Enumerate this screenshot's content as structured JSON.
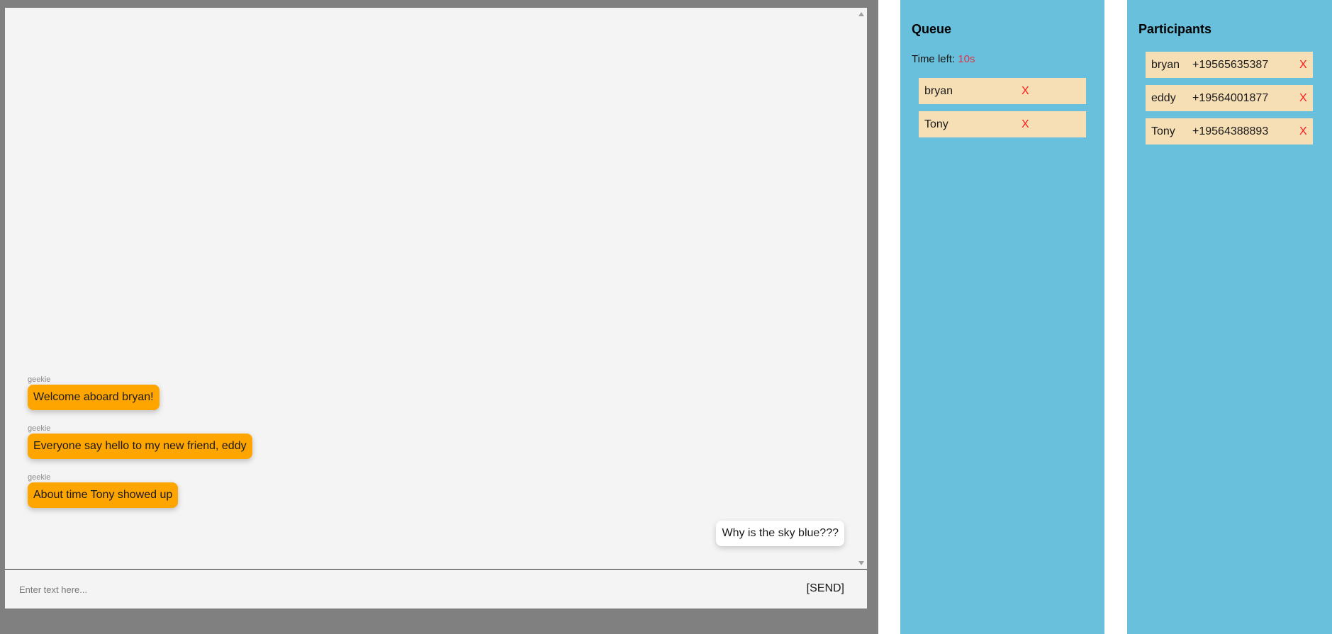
{
  "chat": {
    "messages": [
      {
        "sender": "geekie",
        "text": "Welcome aboard bryan!"
      },
      {
        "sender": "geekie",
        "text": "Everyone say hello to my new friend, eddy"
      },
      {
        "sender": "geekie",
        "text": "About time Tony showed up"
      }
    ],
    "user_message": "Why is the sky blue???",
    "input_placeholder": "Enter text here...",
    "send_label": "[SEND]"
  },
  "queue": {
    "title": "Queue",
    "time_left_label": "Time left:",
    "time_left_value": "10s",
    "items": [
      {
        "name": "bryan",
        "remove": "X"
      },
      {
        "name": "Tony",
        "remove": "X"
      }
    ]
  },
  "participants": {
    "title": "Participants",
    "items": [
      {
        "name": "bryan",
        "phone": "+19565635387",
        "remove": "X"
      },
      {
        "name": "eddy",
        "phone": "+19564001877",
        "remove": "X"
      },
      {
        "name": "Tony",
        "phone": "+19564388893",
        "remove": "X"
      }
    ]
  },
  "colors": {
    "frame": "#808080",
    "chat_bg": "#f4f4f4",
    "bot_bubble": "#ffa500",
    "panel_bg": "#69c0dc",
    "card_bg": "#f6deb5",
    "remove_x": "#ff1a1a",
    "time_value": "#e0324a"
  }
}
